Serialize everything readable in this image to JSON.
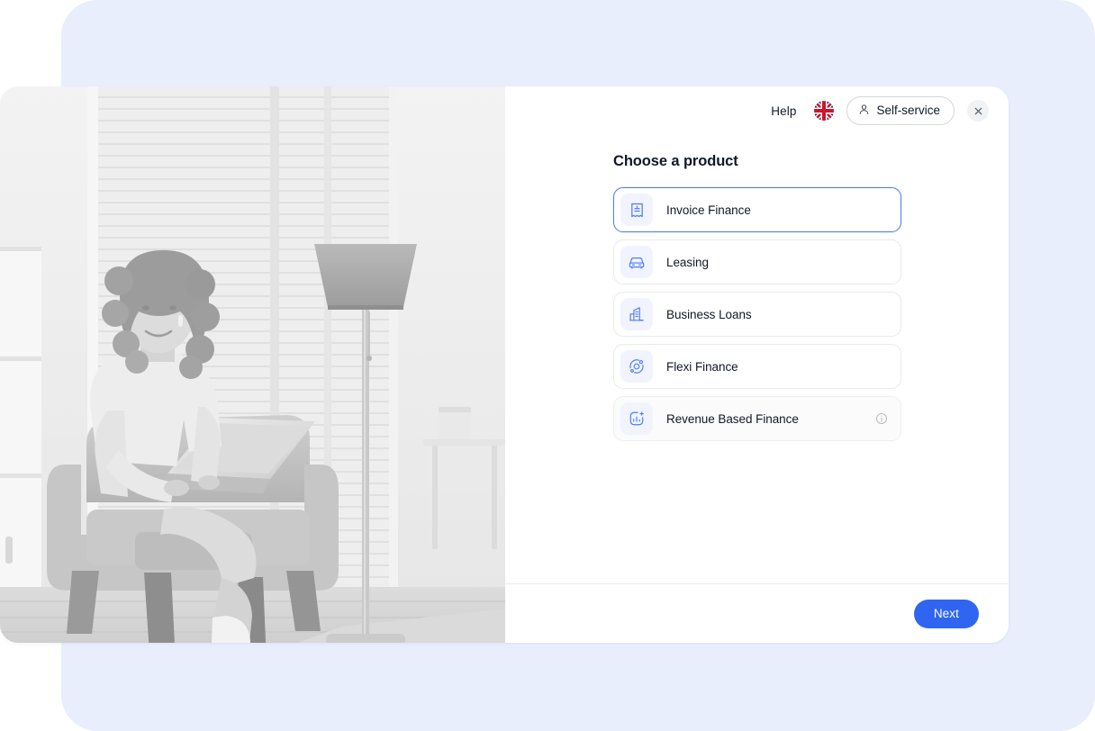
{
  "header": {
    "help_label": "Help",
    "language_flag": "uk-flag-icon",
    "account_label": "Self-service",
    "account_icon": "user-icon",
    "close_icon": "close-icon"
  },
  "main": {
    "title": "Choose a product",
    "products": [
      {
        "label": "Invoice Finance",
        "icon": "invoice-icon",
        "selected": true,
        "muted": false,
        "info": false
      },
      {
        "label": "Leasing",
        "icon": "car-icon",
        "selected": false,
        "muted": false,
        "info": false
      },
      {
        "label": "Business Loans",
        "icon": "building-icon",
        "selected": false,
        "muted": false,
        "info": false
      },
      {
        "label": "Flexi Finance",
        "icon": "orbit-icon",
        "selected": false,
        "muted": false,
        "info": false
      },
      {
        "label": "Revenue Based Finance",
        "icon": "bar-chart-plus-icon",
        "selected": false,
        "muted": true,
        "info": true
      }
    ]
  },
  "footer": {
    "next_label": "Next"
  },
  "colors": {
    "accent": "#2f65f0",
    "icon_blue": "#4f7cf7",
    "icon_bg": "#f1f4fe",
    "backdrop": "#e8eefc",
    "selected_border": "#4f7cf7",
    "text": "#111827"
  },
  "media": {
    "hero_photo": "woman-with-laptop-in-armchair-grayscale"
  }
}
